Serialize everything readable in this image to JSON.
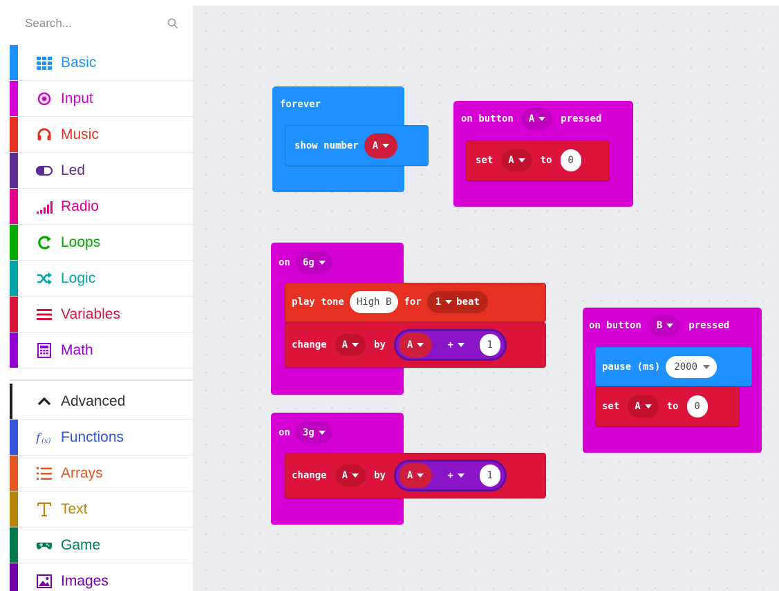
{
  "toolbox": {
    "search_placeholder": "Search...",
    "categories": [
      {
        "label": "Basic",
        "color": "#1e90ff",
        "icon": "grid-icon"
      },
      {
        "label": "Input",
        "color": "#d400d4",
        "icon": "radio-target-icon"
      },
      {
        "label": "Music",
        "color": "#e63022",
        "icon": "headphones-icon"
      },
      {
        "label": "Led",
        "color": "#5c2d91",
        "icon": "toggle-icon"
      },
      {
        "label": "Radio",
        "color": "#e3008c",
        "icon": "signal-bars-icon"
      },
      {
        "label": "Loops",
        "color": "#00aa00",
        "icon": "loop-arrow-icon"
      },
      {
        "label": "Logic",
        "color": "#00a4a6",
        "icon": "shuffle-icon"
      },
      {
        "label": "Variables",
        "color": "#dc143c",
        "icon": "list-lines-icon"
      },
      {
        "label": "Math",
        "color": "#9400d3",
        "icon": "calculator-icon"
      }
    ],
    "advanced": [
      {
        "label": "Advanced",
        "color": "#1f1f1f",
        "icon": "chevron-up-icon"
      },
      {
        "label": "Functions",
        "color": "#3455db",
        "icon": "function-icon"
      },
      {
        "label": "Arrays",
        "color": "#e65722",
        "icon": "numbered-list-icon"
      },
      {
        "label": "Text",
        "color": "#b8860b",
        "icon": "text-t-icon"
      },
      {
        "label": "Game",
        "color": "#007a4b",
        "icon": "gamepad-icon"
      },
      {
        "label": "Images",
        "color": "#7600a8",
        "icon": "image-icon"
      }
    ]
  },
  "blocks": {
    "forever": {
      "title": "forever",
      "show_number": "show number",
      "var": "A"
    },
    "button_a": {
      "on": "on button",
      "button": "A",
      "pressed": "pressed",
      "set": "set",
      "var": "A",
      "to": "to",
      "value": "0"
    },
    "gesture_6g": {
      "on": "on",
      "gesture": "6g",
      "play_tone": "play tone",
      "note": "High B",
      "for": "for",
      "beats": "1",
      "beat": "beat",
      "change": "change",
      "var": "A",
      "by": "by",
      "operand_var": "A",
      "op": "+",
      "operand_value": "1"
    },
    "gesture_3g": {
      "on": "on",
      "gesture": "3g",
      "change": "change",
      "var": "A",
      "by": "by",
      "operand_var": "A",
      "op": "+",
      "operand_value": "1"
    },
    "button_b": {
      "on": "on button",
      "button": "B",
      "pressed": "pressed",
      "pause": "pause (ms)",
      "pause_value": "2000",
      "set": "set",
      "var": "A",
      "to": "to",
      "value": "0"
    }
  },
  "colors": {
    "basic": "#1e90ff",
    "input": "#d400d4",
    "music": "#e63022",
    "variables": "#dc143c",
    "math": "#9400d3",
    "workspace": "#ecedf0"
  }
}
